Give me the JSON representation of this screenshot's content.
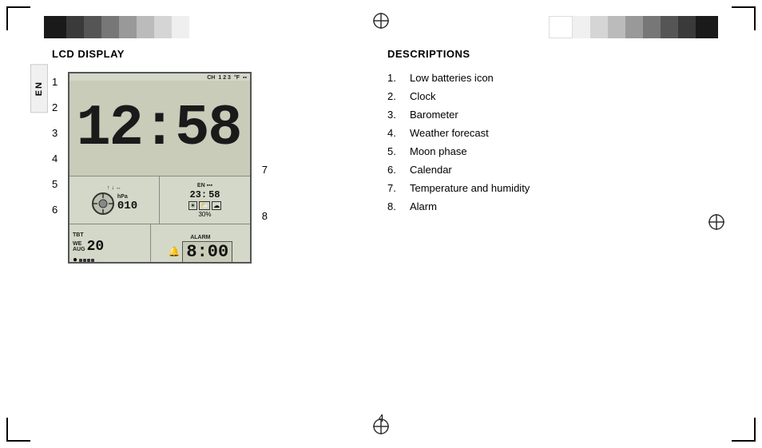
{
  "page": {
    "number": "4",
    "lang": "EN"
  },
  "left_panel": {
    "title": "LCD DISPLAY",
    "labels": {
      "1": "1",
      "2": "2",
      "3": "3",
      "4": "4",
      "5": "5",
      "6": "6",
      "7": "7",
      "8": "8"
    },
    "time_display": "12:58"
  },
  "right_panel": {
    "title": "DESCRIPTIONS",
    "items": [
      {
        "num": "1.",
        "text": "Low batteries icon"
      },
      {
        "num": "2.",
        "text": "Clock"
      },
      {
        "num": "3.",
        "text": "Barometer"
      },
      {
        "num": "4.",
        "text": "Weather forecast"
      },
      {
        "num": "5.",
        "text": "Moon phase"
      },
      {
        "num": "6.",
        "text": "Calendar"
      },
      {
        "num": "7.",
        "text": "Temperature and humidity"
      },
      {
        "num": "8.",
        "text": "Alarm"
      }
    ]
  },
  "colors": {
    "left_strip": [
      "#1a1a1a",
      "#2d2d2d",
      "#555555",
      "#888888",
      "#aaaaaa",
      "#cccccc",
      "#e0e0e0",
      "#f5f5f5"
    ],
    "right_strip": [
      "#f5f5f5",
      "#e0e0e0",
      "#cccccc",
      "#aaaaaa",
      "#888888",
      "#555555",
      "#2d2d2d",
      "#1a1a1a"
    ]
  }
}
